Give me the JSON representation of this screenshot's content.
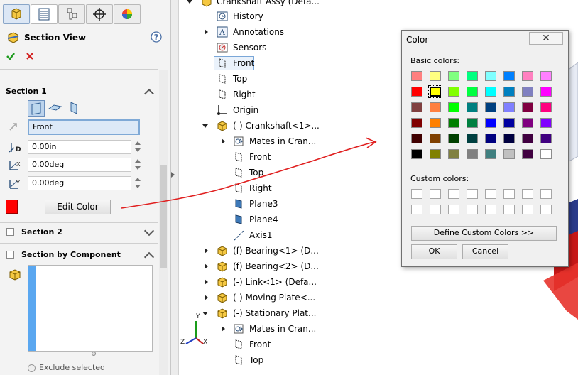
{
  "property_manager": {
    "title": "Section View",
    "section1": {
      "label": "Section 1",
      "plane": "Front",
      "offset": "0.00in",
      "rot_x": "0.00deg",
      "rot_y": "0.00deg",
      "edit_color_label": "Edit Color",
      "current_color": "#ff0000"
    },
    "section2": {
      "label": "Section 2"
    },
    "section_by_component": {
      "label": "Section by Component",
      "exclude_label": "Exclude selected"
    }
  },
  "tree": {
    "assembly": "Crankshaft Assy (Defa...",
    "items": [
      {
        "label": "History"
      },
      {
        "label": "Annotations"
      },
      {
        "label": "Sensors"
      },
      {
        "label": "Front"
      },
      {
        "label": "Top"
      },
      {
        "label": "Right"
      },
      {
        "label": "Origin"
      },
      {
        "label": "(-) Crankshaft<1>..."
      },
      {
        "label": "Mates in Cran..."
      },
      {
        "label": "Front"
      },
      {
        "label": "Top"
      },
      {
        "label": "Right"
      },
      {
        "label": "Plane3"
      },
      {
        "label": "Plane4"
      },
      {
        "label": "Axis1"
      },
      {
        "label": "(f) Bearing<1> (D..."
      },
      {
        "label": "(f) Bearing<2> (D..."
      },
      {
        "label": "(-) Link<1> (Defa..."
      },
      {
        "label": "(-) Moving Plate<..."
      },
      {
        "label": "(-) Stationary Plat..."
      },
      {
        "label": "Mates in Cran..."
      },
      {
        "label": "Front"
      },
      {
        "label": "Top"
      }
    ]
  },
  "color_dialog": {
    "title": "Color",
    "close_label": "✕",
    "basic_colors_label": "Basic colors:",
    "custom_colors_label": "Custom colors:",
    "define_custom_label": "Define Custom Colors >>",
    "ok_label": "OK",
    "cancel_label": "Cancel",
    "selected_basic_color": "#ffff00",
    "basic_colors": [
      [
        "#ff8080",
        "#ffff80",
        "#80ff80",
        "#00ff80",
        "#80ffff",
        "#0080ff",
        "#ff80c0",
        "#ff80ff"
      ],
      [
        "#ff0000",
        "#ffff00",
        "#80ff00",
        "#00ff40",
        "#00ffff",
        "#0080c0",
        "#8080c0",
        "#ff00ff"
      ],
      [
        "#804040",
        "#ff8040",
        "#00ff00",
        "#008080",
        "#004080",
        "#8080ff",
        "#800040",
        "#ff0080"
      ],
      [
        "#800000",
        "#ff8000",
        "#008000",
        "#008040",
        "#0000ff",
        "#0000a0",
        "#800080",
        "#8000ff"
      ],
      [
        "#400000",
        "#804000",
        "#004000",
        "#004040",
        "#000080",
        "#000040",
        "#400040",
        "#400080"
      ],
      [
        "#000000",
        "#808000",
        "#808040",
        "#808080",
        "#408080",
        "#c0c0c0",
        "#400040",
        "#ffffff"
      ]
    ]
  },
  "triad": {
    "x": "X",
    "y": "Y",
    "z": "Z"
  }
}
